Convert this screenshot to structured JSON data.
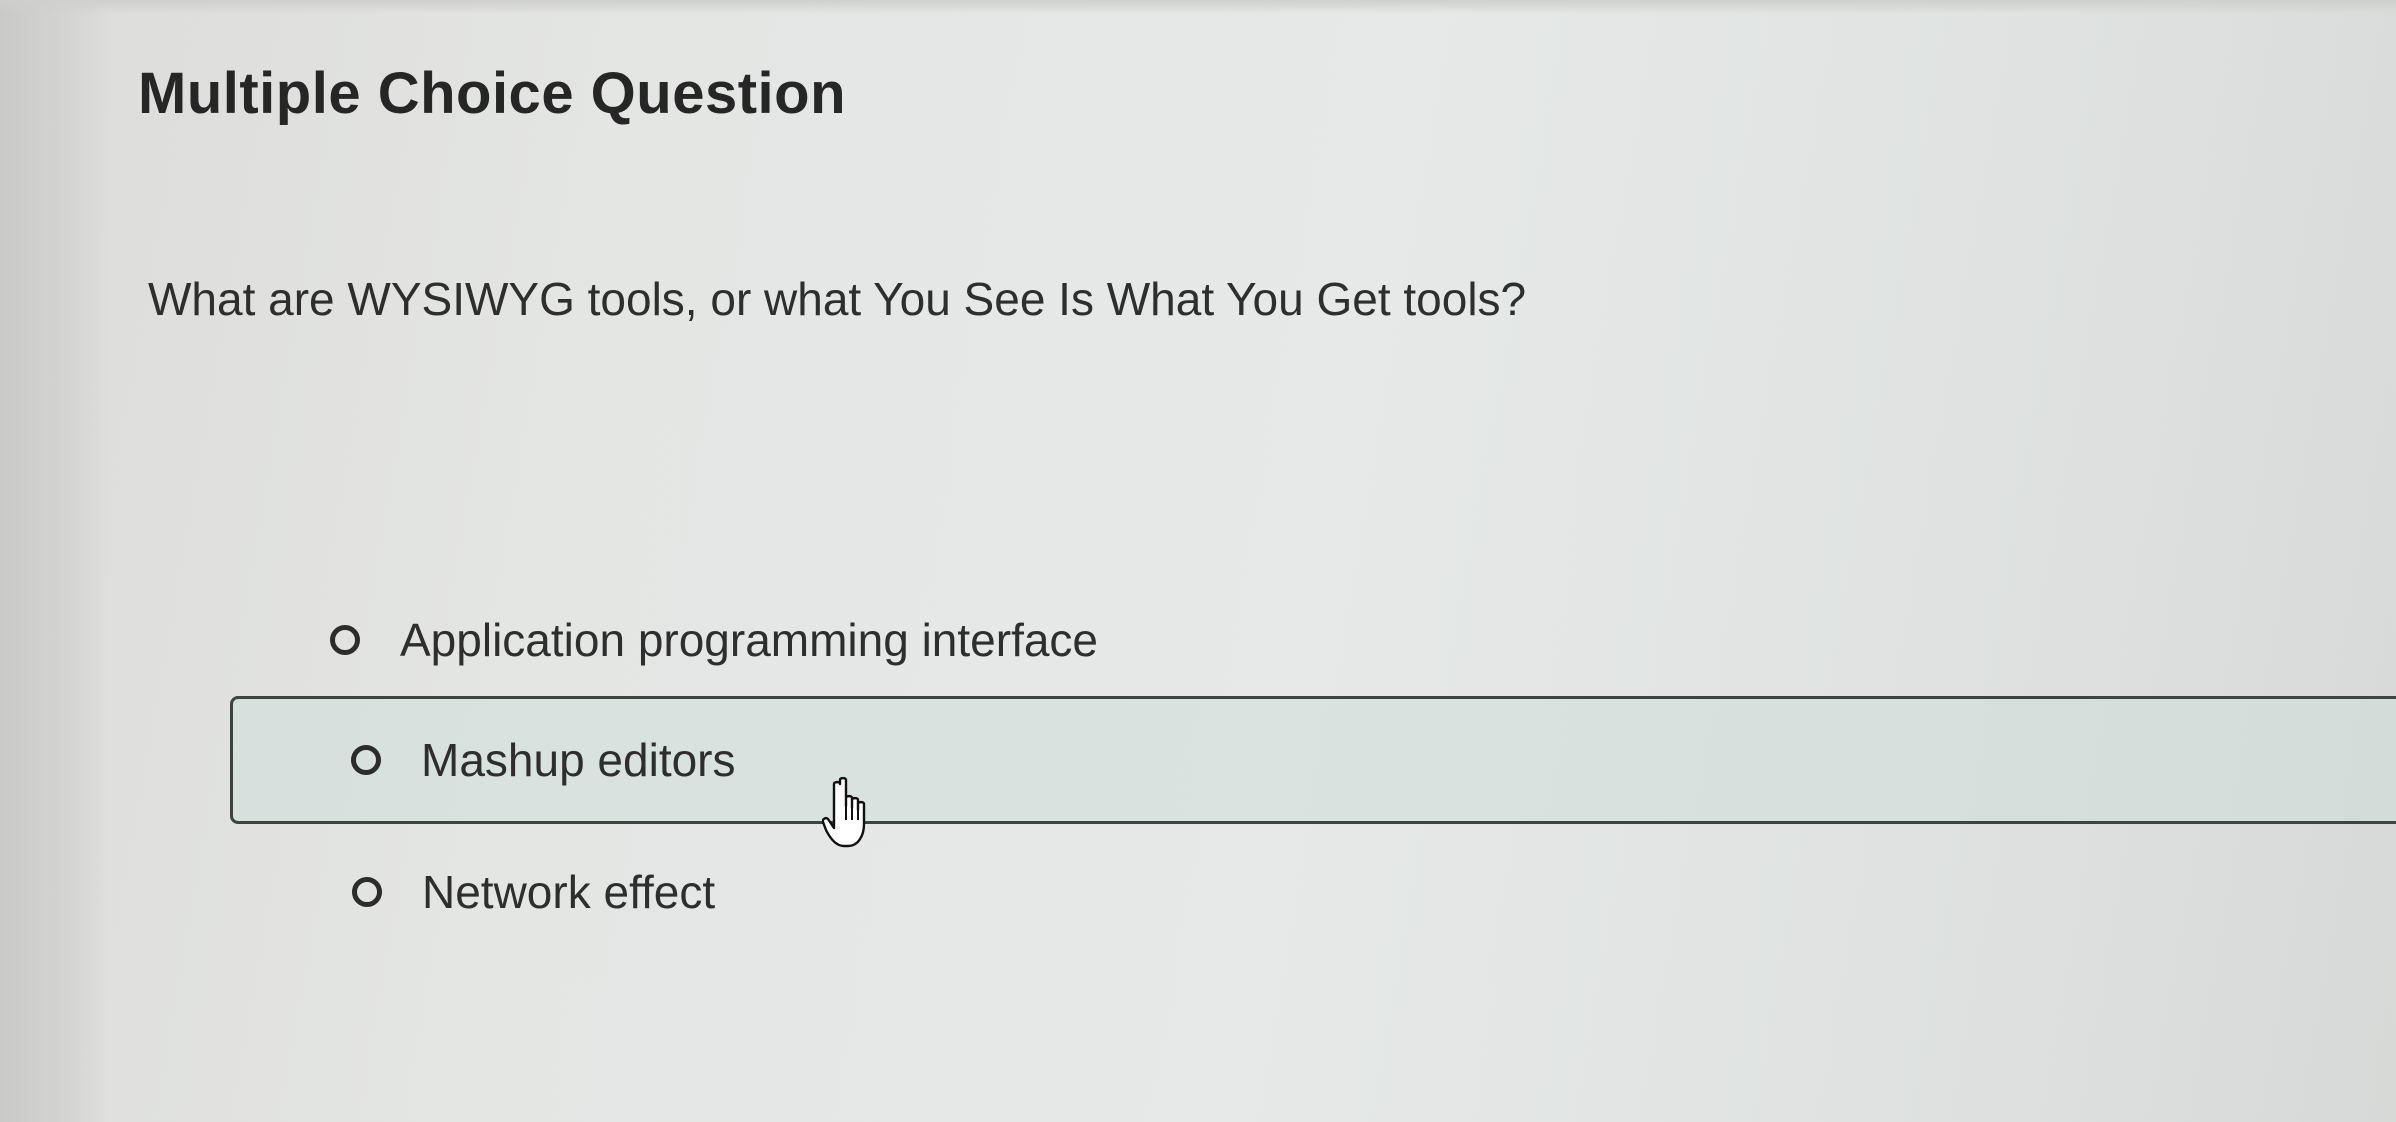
{
  "question": {
    "type_label": "Multiple Choice Question",
    "prompt": "What are WYSIWYG tools, or what You See Is What You Get tools?"
  },
  "options": [
    {
      "label": "Application programming interface",
      "selected": false,
      "hovered": false
    },
    {
      "label": "Mashup editors",
      "selected": false,
      "hovered": true
    },
    {
      "label": "Network effect",
      "selected": false,
      "hovered": false
    }
  ],
  "icons": {
    "radio": "radio-unchecked-icon",
    "cursor": "hand-pointer-cursor-icon"
  },
  "colors": {
    "text": "#2e2e2e",
    "hover_fill": "#cdded8",
    "hover_border": "#3c4540"
  }
}
